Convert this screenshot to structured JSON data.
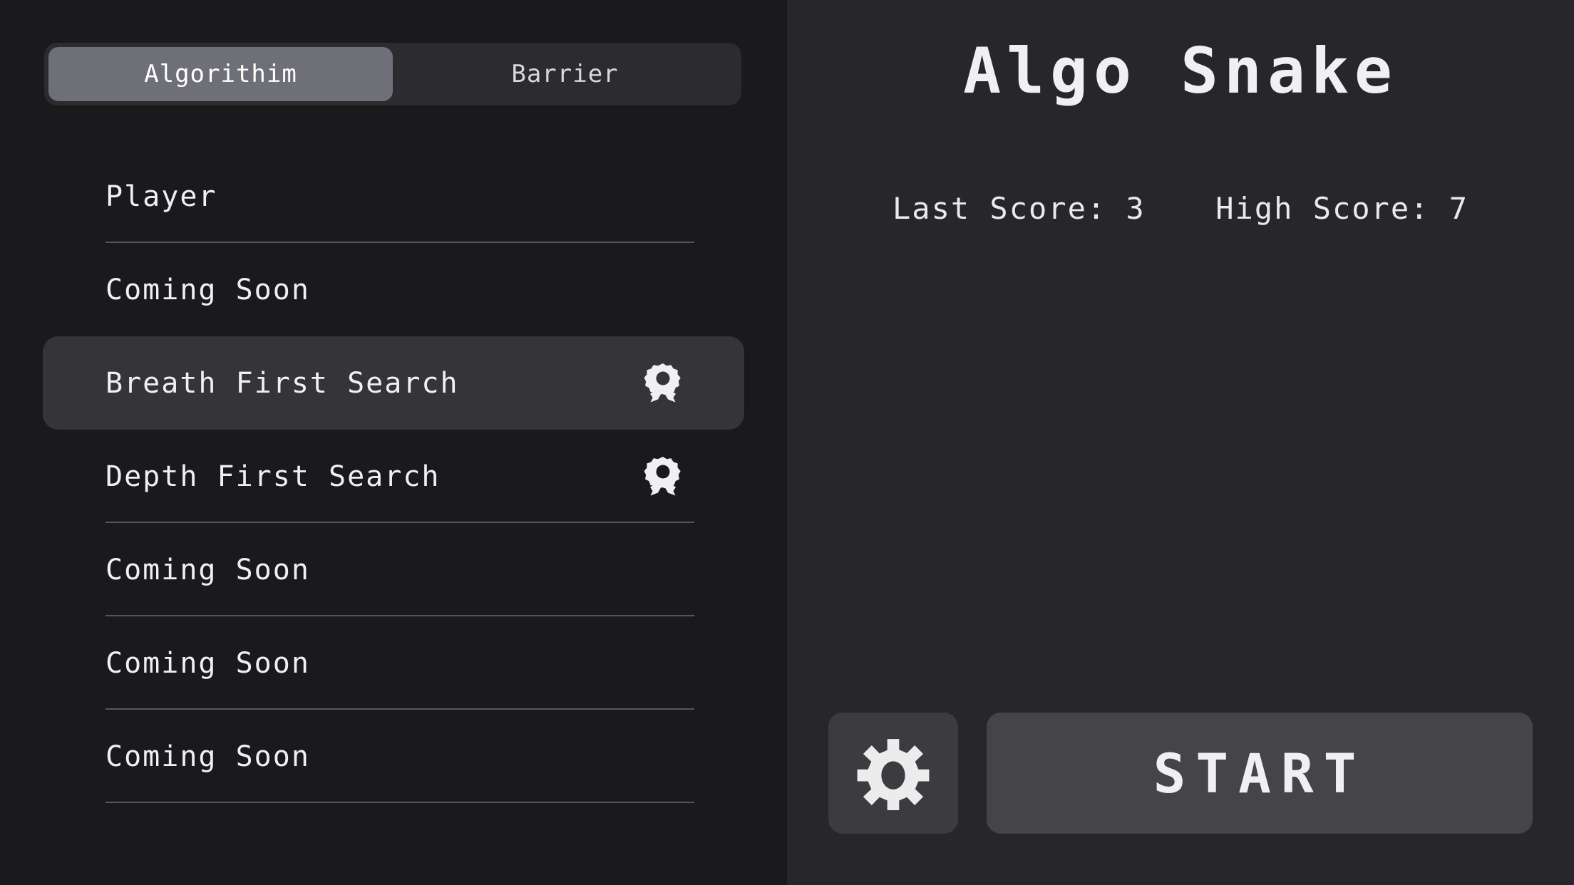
{
  "colors": {
    "left_panel_bg": "#1a1a1c",
    "right_panel_bg": "#26262b",
    "tabbar_bg": "#2b2b30",
    "tab_active_bg": "#6f6f78",
    "row_selected_bg": "#353539",
    "divider": "#55555c",
    "text_primary": "#f0f0f4",
    "settings_button_bg": "#3b3b40",
    "start_button_bg": "#454549"
  },
  "sidebar": {
    "tabs": [
      {
        "label": "Algorithim",
        "active": true
      },
      {
        "label": "Barrier",
        "active": false
      }
    ],
    "rows": [
      {
        "label": "Player",
        "selected": false,
        "medal": false,
        "divider": true
      },
      {
        "label": "Coming Soon",
        "selected": false,
        "medal": false,
        "divider": false
      },
      {
        "label": "Breath First Search",
        "selected": true,
        "medal": true,
        "divider": false
      },
      {
        "label": "Depth First Search",
        "selected": false,
        "medal": true,
        "divider": true
      },
      {
        "label": "Coming Soon",
        "selected": false,
        "medal": false,
        "divider": true
      },
      {
        "label": "Coming Soon",
        "selected": false,
        "medal": false,
        "divider": true
      },
      {
        "label": "Coming Soon",
        "selected": false,
        "medal": false,
        "divider": true
      }
    ]
  },
  "game": {
    "title": "Algo Snake",
    "last_score_label": "Last Score: 3",
    "high_score_label": "High Score: 7",
    "last_score_value": 3,
    "high_score_value": 7
  },
  "actions": {
    "settings_icon": "gear-icon",
    "start_label": "START"
  },
  "icons": {
    "medal": "award-medal-icon",
    "gear": "gear-icon"
  }
}
